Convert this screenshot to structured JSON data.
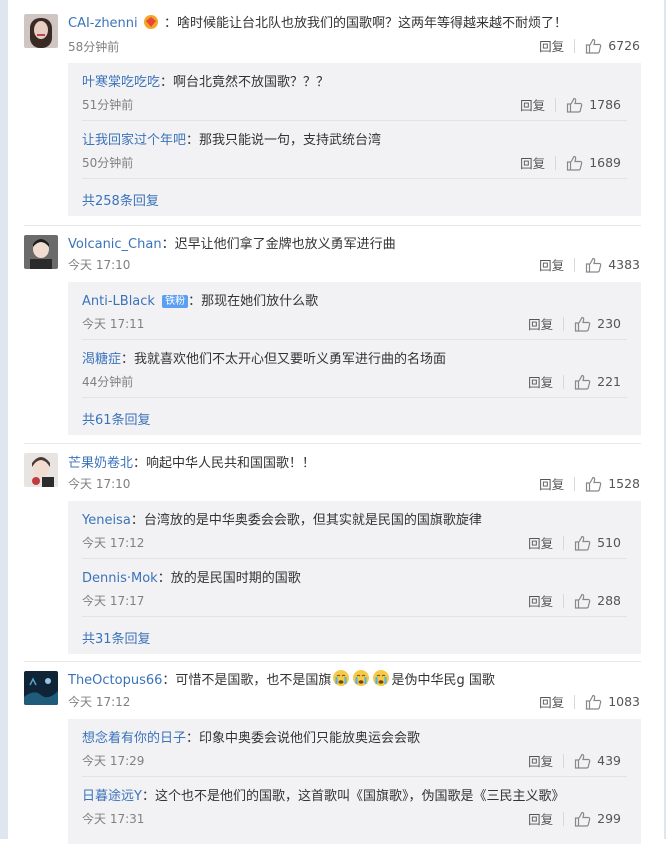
{
  "common": {
    "reply_label": "回复"
  },
  "threads": [
    {
      "user": "CAI-zhenni",
      "text": "：啥时候能让台北队也放我们的国歌啊？这两年等得越来越不耐烦了！",
      "time": "58分钟前",
      "likes": "6726",
      "replies": [
        {
          "user": "叶寒棠吃吃吃",
          "text": "：啊台北竟然不放国歌？？？",
          "time": "51分钟前",
          "likes": "1786"
        },
        {
          "user": "让我回家过个年吧",
          "text": "：那我只能说一句，支持武统台湾",
          "time": "50分钟前",
          "likes": "1689"
        }
      ],
      "more": "共258条回复"
    },
    {
      "user": "Volcanic_Chan",
      "text": "：迟早让他们拿了金牌也放义勇军进行曲",
      "time": "今天 17:10",
      "likes": "4383",
      "replies": [
        {
          "user": "Anti-LBlack",
          "badge": "铁粉",
          "text": "：那现在她们放什么歌",
          "time": "今天 17:11",
          "likes": "230"
        },
        {
          "user": "渴糖症",
          "text": "：我就喜欢他们不太开心但又要听义勇军进行曲的名场面",
          "time": "44分钟前",
          "likes": "221"
        }
      ],
      "more": "共61条回复"
    },
    {
      "user": "芒果奶卷北",
      "text": "：响起中华人民共和国国歌！！",
      "time": "今天 17:10",
      "likes": "1528",
      "replies": [
        {
          "user": "Yeneisa",
          "text": "：台湾放的是中华奥委会会歌，但其实就是民国的国旗歌旋律",
          "time": "今天 17:12",
          "likes": "510"
        },
        {
          "user": "Dennis·Mok",
          "text": "：放的是民国时期的国歌",
          "time": "今天 17:17",
          "likes": "288"
        }
      ],
      "more": "共31条回复"
    },
    {
      "user": "TheOctopus66",
      "text_before": "：可惜不是国歌，也不是国旗",
      "text_after": "是伪中华民g 国歌",
      "time": "今天 17:12",
      "likes": "1083",
      "replies": [
        {
          "user": "想念着有你的日子",
          "text": "：印象中奥委会说他们只能放奥运会会歌",
          "time": "今天 17:29",
          "likes": "439"
        },
        {
          "user": "日暮途远Y",
          "text": "：这个也不是他们的国歌，这首歌叫《国旗歌》，伪国歌是《三民主义歌》",
          "time": "今天 17:31",
          "likes": "299"
        }
      ]
    }
  ],
  "icons": {
    "like": "thumbs-up-icon",
    "crying_emoji": "crying-face-icon",
    "verified": "vip-badge-icon"
  },
  "colors": {
    "link": "#3b73b9",
    "time": "#808080",
    "sub_bg": "#f2f2f5",
    "badge": "#5c9ef0"
  }
}
